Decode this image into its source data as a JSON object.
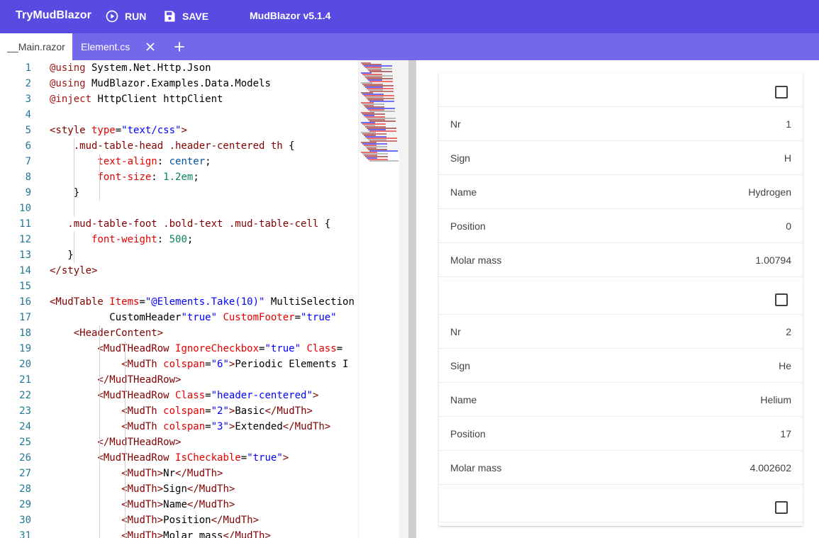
{
  "appbar": {
    "brand": "TryMudBlazor",
    "run_label": "RUN",
    "save_label": "SAVE",
    "version": "MudBlazor v5.1.4",
    "color": "#594ae2"
  },
  "tabs": {
    "items": [
      {
        "label": "__Main.razor",
        "active": true
      },
      {
        "label": "Element.cs",
        "active": false
      }
    ],
    "close_icon": "close-icon",
    "add_icon": "plus-icon"
  },
  "editor": {
    "lines": [
      {
        "n": "1",
        "text": "@using System.Net.Http.Json"
      },
      {
        "n": "2",
        "text": "@using MudBlazor.Examples.Data.Models"
      },
      {
        "n": "3",
        "text": "@inject HttpClient httpClient"
      },
      {
        "n": "4",
        "text": ""
      },
      {
        "n": "5",
        "text": "<style type=\"text/css\">"
      },
      {
        "n": "6",
        "text": "    .mud-table-head .header-centered th {"
      },
      {
        "n": "7",
        "text": "        text-align: center;"
      },
      {
        "n": "8",
        "text": "        font-size: 1.2em;"
      },
      {
        "n": "9",
        "text": "    }"
      },
      {
        "n": "10",
        "text": ""
      },
      {
        "n": "11",
        "text": "   .mud-table-foot .bold-text .mud-table-cell {"
      },
      {
        "n": "12",
        "text": "       font-weight: 500;"
      },
      {
        "n": "13",
        "text": "   }"
      },
      {
        "n": "14",
        "text": "</style>"
      },
      {
        "n": "15",
        "text": ""
      },
      {
        "n": "16",
        "text": "<MudTable Items=\"@Elements.Take(10)\" MultiSelection"
      },
      {
        "n": "17",
        "text": "          CustomHeader=\"true\" CustomFooter=\"true\""
      },
      {
        "n": "18",
        "text": "    <HeaderContent>"
      },
      {
        "n": "19",
        "text": "        <MudTHeadRow IgnoreCheckbox=\"true\" Class="
      },
      {
        "n": "20",
        "text": "            <MudTh colspan=\"6\">Periodic Elements I"
      },
      {
        "n": "21",
        "text": "        </MudTHeadRow>"
      },
      {
        "n": "22",
        "text": "        <MudTHeadRow Class=\"header-centered\">"
      },
      {
        "n": "23",
        "text": "            <MudTh colspan=\"2\">Basic</MudTh>"
      },
      {
        "n": "24",
        "text": "            <MudTh colspan=\"3\">Extended</MudTh>"
      },
      {
        "n": "25",
        "text": "        </MudTHeadRow>"
      },
      {
        "n": "26",
        "text": "        <MudTHeadRow IsCheckable=\"true\">"
      },
      {
        "n": "27",
        "text": "            <MudTh>Nr</MudTh>"
      },
      {
        "n": "28",
        "text": "            <MudTh>Sign</MudTh>"
      },
      {
        "n": "29",
        "text": "            <MudTh>Name</MudTh>"
      },
      {
        "n": "30",
        "text": "            <MudTh>Position</MudTh>"
      },
      {
        "n": "31",
        "text": "            <MudTh>Molar mass</MudTh>"
      }
    ]
  },
  "preview": {
    "records": [
      {
        "fields": [
          {
            "label": "Nr",
            "value": "1"
          },
          {
            "label": "Sign",
            "value": "H"
          },
          {
            "label": "Name",
            "value": "Hydrogen"
          },
          {
            "label": "Position",
            "value": "0"
          },
          {
            "label": "Molar mass",
            "value": "1.00794"
          }
        ]
      },
      {
        "fields": [
          {
            "label": "Nr",
            "value": "2"
          },
          {
            "label": "Sign",
            "value": "He"
          },
          {
            "label": "Name",
            "value": "Helium"
          },
          {
            "label": "Position",
            "value": "17"
          },
          {
            "label": "Molar mass",
            "value": "4.002602"
          }
        ]
      },
      {
        "fields": []
      }
    ]
  }
}
